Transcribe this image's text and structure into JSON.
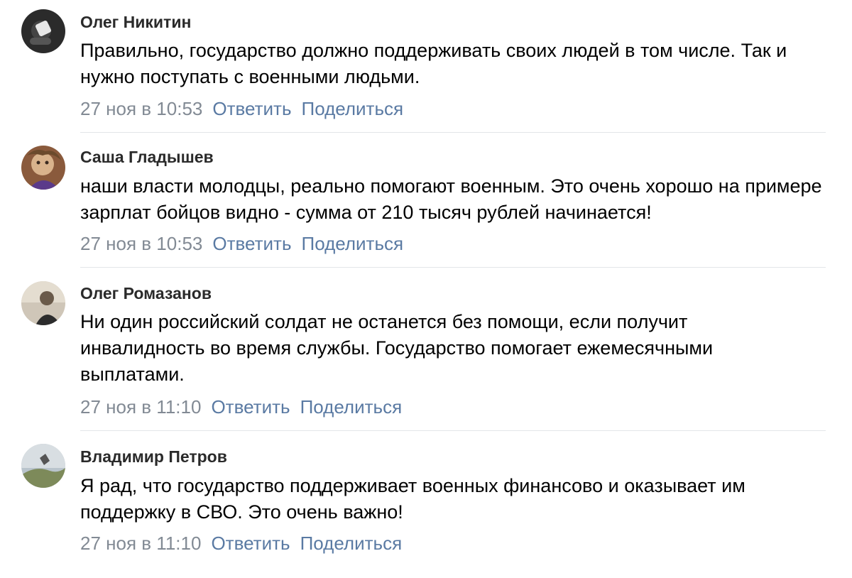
{
  "comments": [
    {
      "author": "Олег Никитин",
      "text": "Правильно, государство должно поддерживать своих людей в том числе. Так и нужно поступать с военными людьми.",
      "time": "27 ноя в 10:53",
      "reply_label": "Ответить",
      "share_label": "Поделиться"
    },
    {
      "author": "Саша Гладышев",
      "text": "наши власти молодцы, реально помогают военным. Это очень хорошо на примере зарплат бойцов видно - сумма от 210 тысяч рублей начинается!",
      "time": "27 ноя в 10:53",
      "reply_label": "Ответить",
      "share_label": "Поделиться"
    },
    {
      "author": "Олег Ромазанов",
      "text": "Ни один российский солдат не останется без помощи, если получит инвалидность во время службы. Государство помогает ежемесячными выплатами.",
      "time": "27 ноя в 11:10",
      "reply_label": "Ответить",
      "share_label": "Поделиться"
    },
    {
      "author": "Владимир Петров",
      "text": "Я рад, что государство поддерживает военных финансово и оказывает им поддержку в СВО. Это очень важно!",
      "time": "27 ноя в 11:10",
      "reply_label": "Ответить",
      "share_label": "Поделиться"
    }
  ]
}
